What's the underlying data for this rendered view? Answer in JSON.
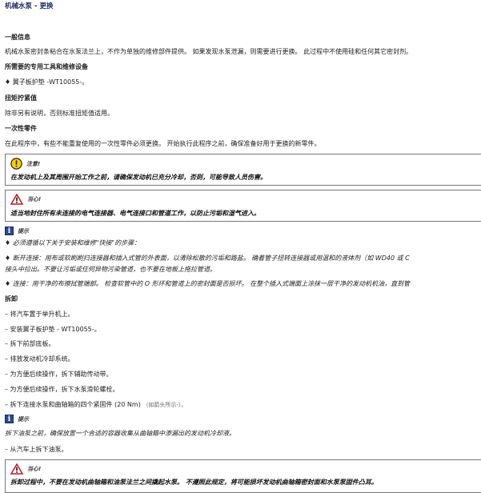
{
  "title": "机械水泵 - 更换",
  "general": {
    "heading": "一般信息",
    "text": "机械水泵密封条粘合在水泵法兰上，不作为单独的维修部件提供。 如果发现水泵泄漏，则需要进行更换。 此过程中不使用硅和任何其它密封剂。"
  },
  "tools": {
    "heading": "所需要的专用工具和维修设备",
    "item": "♦ 翼子板护垫 -WT10055-。"
  },
  "torque": {
    "heading": "扭矩拧紧值",
    "text": "除非另有说明，否则标准扭矩值适用。"
  },
  "single_use": {
    "heading": "一次性零件",
    "text": "在此程序中，有些不能重复使用的一次性零件必须更换。 开始执行此程序之前，确保准备好用于更换的新零件。"
  },
  "caution1": {
    "label": "注意!",
    "text": "在发动机上及其周围开始工作之前，请确保发动机已充分冷却，否则，可能导致人员伤害。"
  },
  "warning1": {
    "label": "当心!",
    "text": "适当地封住所有未连接的电气连接器、电气连接口和管道工作，以防止污垢和湿气进入。"
  },
  "note1": {
    "label": "提示",
    "lines": [
      "♦  必须遵循以下关于安装和维修\"快接\"的步骤：",
      "♦  断开连接：用布或软刷刷扫连接器和插入式管的外表面，以清除松散的污垢和路盐。 确着管子扭转连接器或用温和的液体剂（如 WD40 或 C",
      "    接头中拉出。不要让污垢或任何异物污染管道，也不要在地板上拖拉管道。",
      "♦  连接：用干净的布擦拭管端部。 检查软管中的 O 形环和管道上的密封面是否损坏。 在整个插入式端面上涂抹一层干净的发动机机油，直到管"
    ]
  },
  "removal": {
    "heading": "拆卸",
    "steps": [
      "–  将汽车置于举升机上。",
      "–  安装翼子板护垫 - WT10055-。",
      "–  拆下前部底板。",
      "–  排放发动机冷却系统。",
      "–  为方便后续操作，拆下辅助传动带。",
      "–  为方便后续操作，拆下水泵滑轮螺栓。",
      "–  拆下连接水泵和曲轴箱的四个紧固件 (20 Nm)"
    ],
    "step7_hint": "（如箭头所示-）。"
  },
  "note2": {
    "label": "提示",
    "text": "拆下油泵之前，确保放置一个合适的容器收集从曲轴箱中渗漏出的发动机冷却液。"
  },
  "step_after_note": "–  从汽车上拆下油泵。",
  "warning2": {
    "label": "当心!",
    "text": "拆卸过程中，不要在发动机曲轴箱和油泵法兰之间撬起水泵。 不遵照此规定，将可能损坏发动机曲轴箱密封面和水泵泵固件凸耳。"
  }
}
